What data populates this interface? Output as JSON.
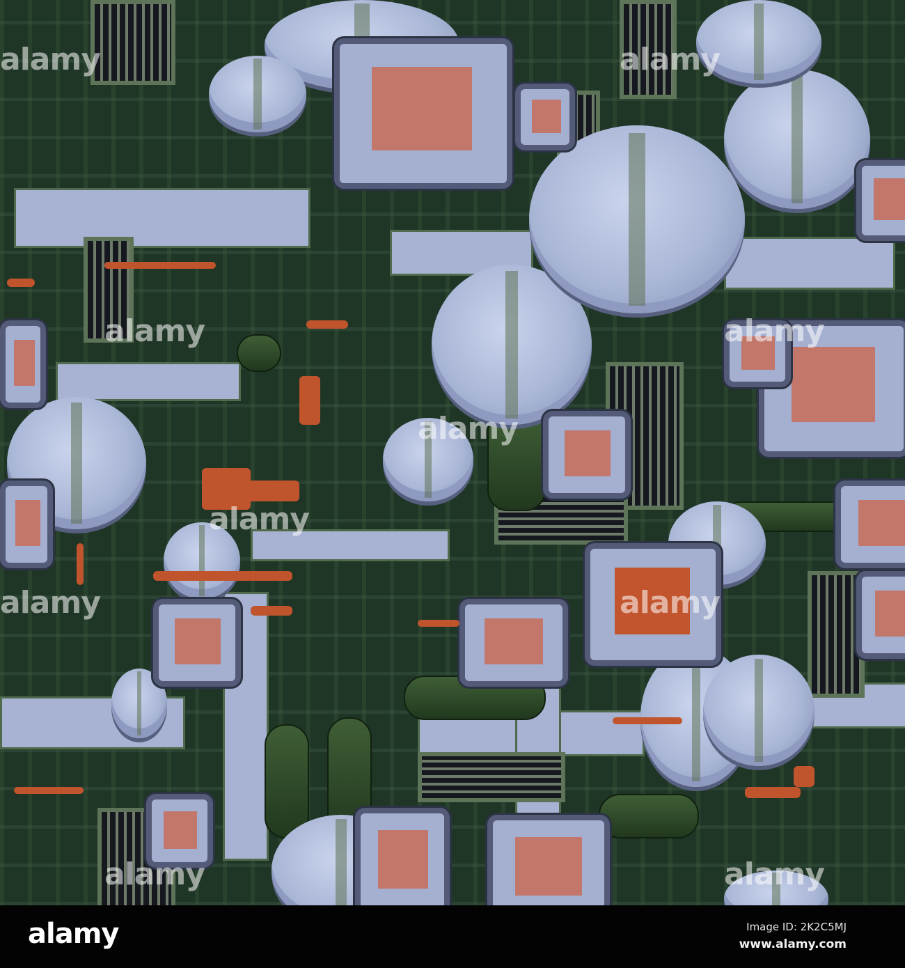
{
  "image": {
    "description_alt": "3D sci-fi machinery texture",
    "colors": {
      "background": "#1f3526",
      "panel": "#a5b0d0",
      "accent": "#c2552e",
      "frame": "#535b78"
    }
  },
  "watermark": {
    "text": "alamy"
  },
  "footer": {
    "logo": "alamy",
    "image_id": "Image ID: 2K2C5MJ",
    "url": "www.alamy.com"
  }
}
